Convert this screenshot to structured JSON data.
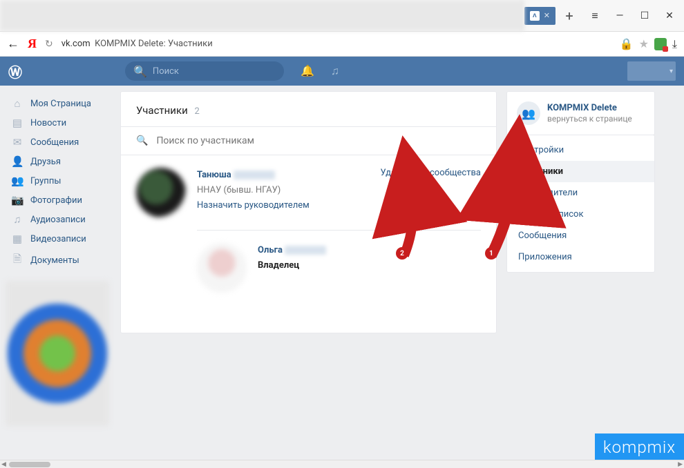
{
  "browser": {
    "tab_label": "VK",
    "address_domain": "vk.com",
    "address_title": "KOMPMIX Delete: Участники"
  },
  "header": {
    "logo": "VK",
    "search_placeholder": "Поиск"
  },
  "leftnav": {
    "items": [
      {
        "icon": "⌂",
        "label": "Моя Страница"
      },
      {
        "icon": "▤",
        "label": "Новости"
      },
      {
        "icon": "✉",
        "label": "Сообщения"
      },
      {
        "icon": "👤",
        "label": "Друзья"
      },
      {
        "icon": "👥",
        "label": "Группы"
      },
      {
        "icon": "📷",
        "label": "Фотографии"
      },
      {
        "icon": "♫",
        "label": "Аудиозаписи"
      },
      {
        "icon": "▦",
        "label": "Видеозаписи"
      },
      {
        "icon": "🗎",
        "label": "Документы"
      }
    ]
  },
  "card": {
    "title": "Участники",
    "count": "2",
    "search_placeholder": "Поиск по участникам",
    "members": [
      {
        "name": "Танюша",
        "subtitle": "ННАУ (бывш. НГАУ)",
        "role_link": "Назначить руководителем",
        "action": "Удалить из сообщества"
      },
      {
        "name": "Ольга",
        "owner": "Владелец"
      }
    ]
  },
  "right": {
    "group_name": "KOMPMIX Delete",
    "back_text": "вернуться к странице",
    "menu": [
      {
        "label": "Настройки",
        "active": false
      },
      {
        "label": "Участники",
        "active": true
      },
      {
        "label": "Руководители",
        "active": false
      },
      {
        "label": "Чёрный список",
        "active": false
      },
      {
        "label": "Сообщения",
        "active": false
      },
      {
        "label": "Приложения",
        "active": false
      }
    ]
  },
  "annotations": {
    "arrow1": "1",
    "arrow2": "2"
  },
  "watermark": "kompmix"
}
